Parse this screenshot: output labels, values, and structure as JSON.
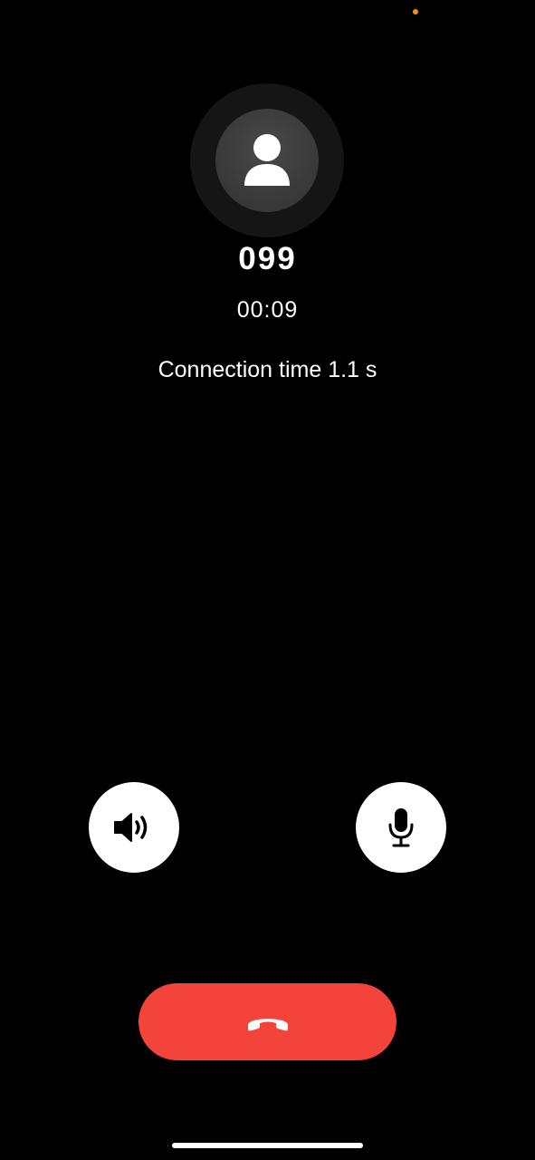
{
  "call": {
    "caller": "099",
    "duration": "00:09",
    "connection_info": "Connection time 1.1 s"
  },
  "controls": {
    "speaker_icon": "speaker-icon",
    "mic_icon": "microphone-icon",
    "end_call_icon": "phone-hangup-icon"
  },
  "colors": {
    "background": "#000000",
    "end_call": "#f4433a",
    "privacy_dot": "#f0901a",
    "button": "#ffffff"
  }
}
